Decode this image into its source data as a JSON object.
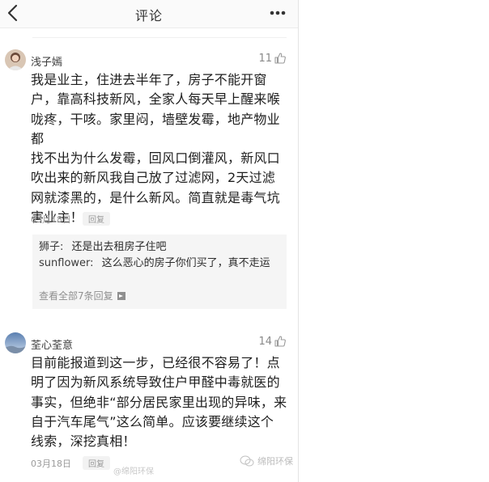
{
  "header": {
    "title": "评论",
    "back_icon": "chevron-left-icon",
    "more_icon": "more-dots-icon"
  },
  "comments": [
    {
      "username": "浅子嫣",
      "likes": "11",
      "text_lines": [
        "我是业主，住进去半年了，房子不能开窗",
        "户，靠高科技新风，全家人每天早上醒来喉",
        "咙疼，干咳。家里闷，墙壁发霉，地产物业都",
        "找不出为什么发霉，回风口倒灌风，新风口",
        "吹出来的新风我自己放了过滤网，2天过滤",
        "网就漆黑的，是什么新风。简直就是毒气坑",
        "害业主！"
      ],
      "date": "03月18日",
      "reply_label": "回复",
      "replies": [
        {
          "user": "狮子:",
          "text": "还是出去租房子住吧"
        },
        {
          "user": "sunflower:",
          "text": "这么恶心的房子你们买了，真不走运"
        }
      ],
      "view_all": "查看全部7条回复"
    },
    {
      "username": "荃心荃意",
      "likes": "14",
      "text_lines": [
        "目前能报道到这一步，已经很不容易了！点",
        "明了因为新风系统导致住户甲醛中毒就医的",
        "事实，但绝非“部分居民家里出现的异味，来",
        "自于汽车尾气”这么简单。应该要继续这个",
        "线索，深挖真相！"
      ],
      "date": "03月18日",
      "reply_label": "回复"
    }
  ],
  "watermark": {
    "text": "绵阳环保",
    "blurred_text": "@绵阳环保"
  },
  "colors": {
    "text": "#1e1e1e",
    "muted": "#9a9a9a",
    "reply_bg": "#f5f5f5"
  }
}
